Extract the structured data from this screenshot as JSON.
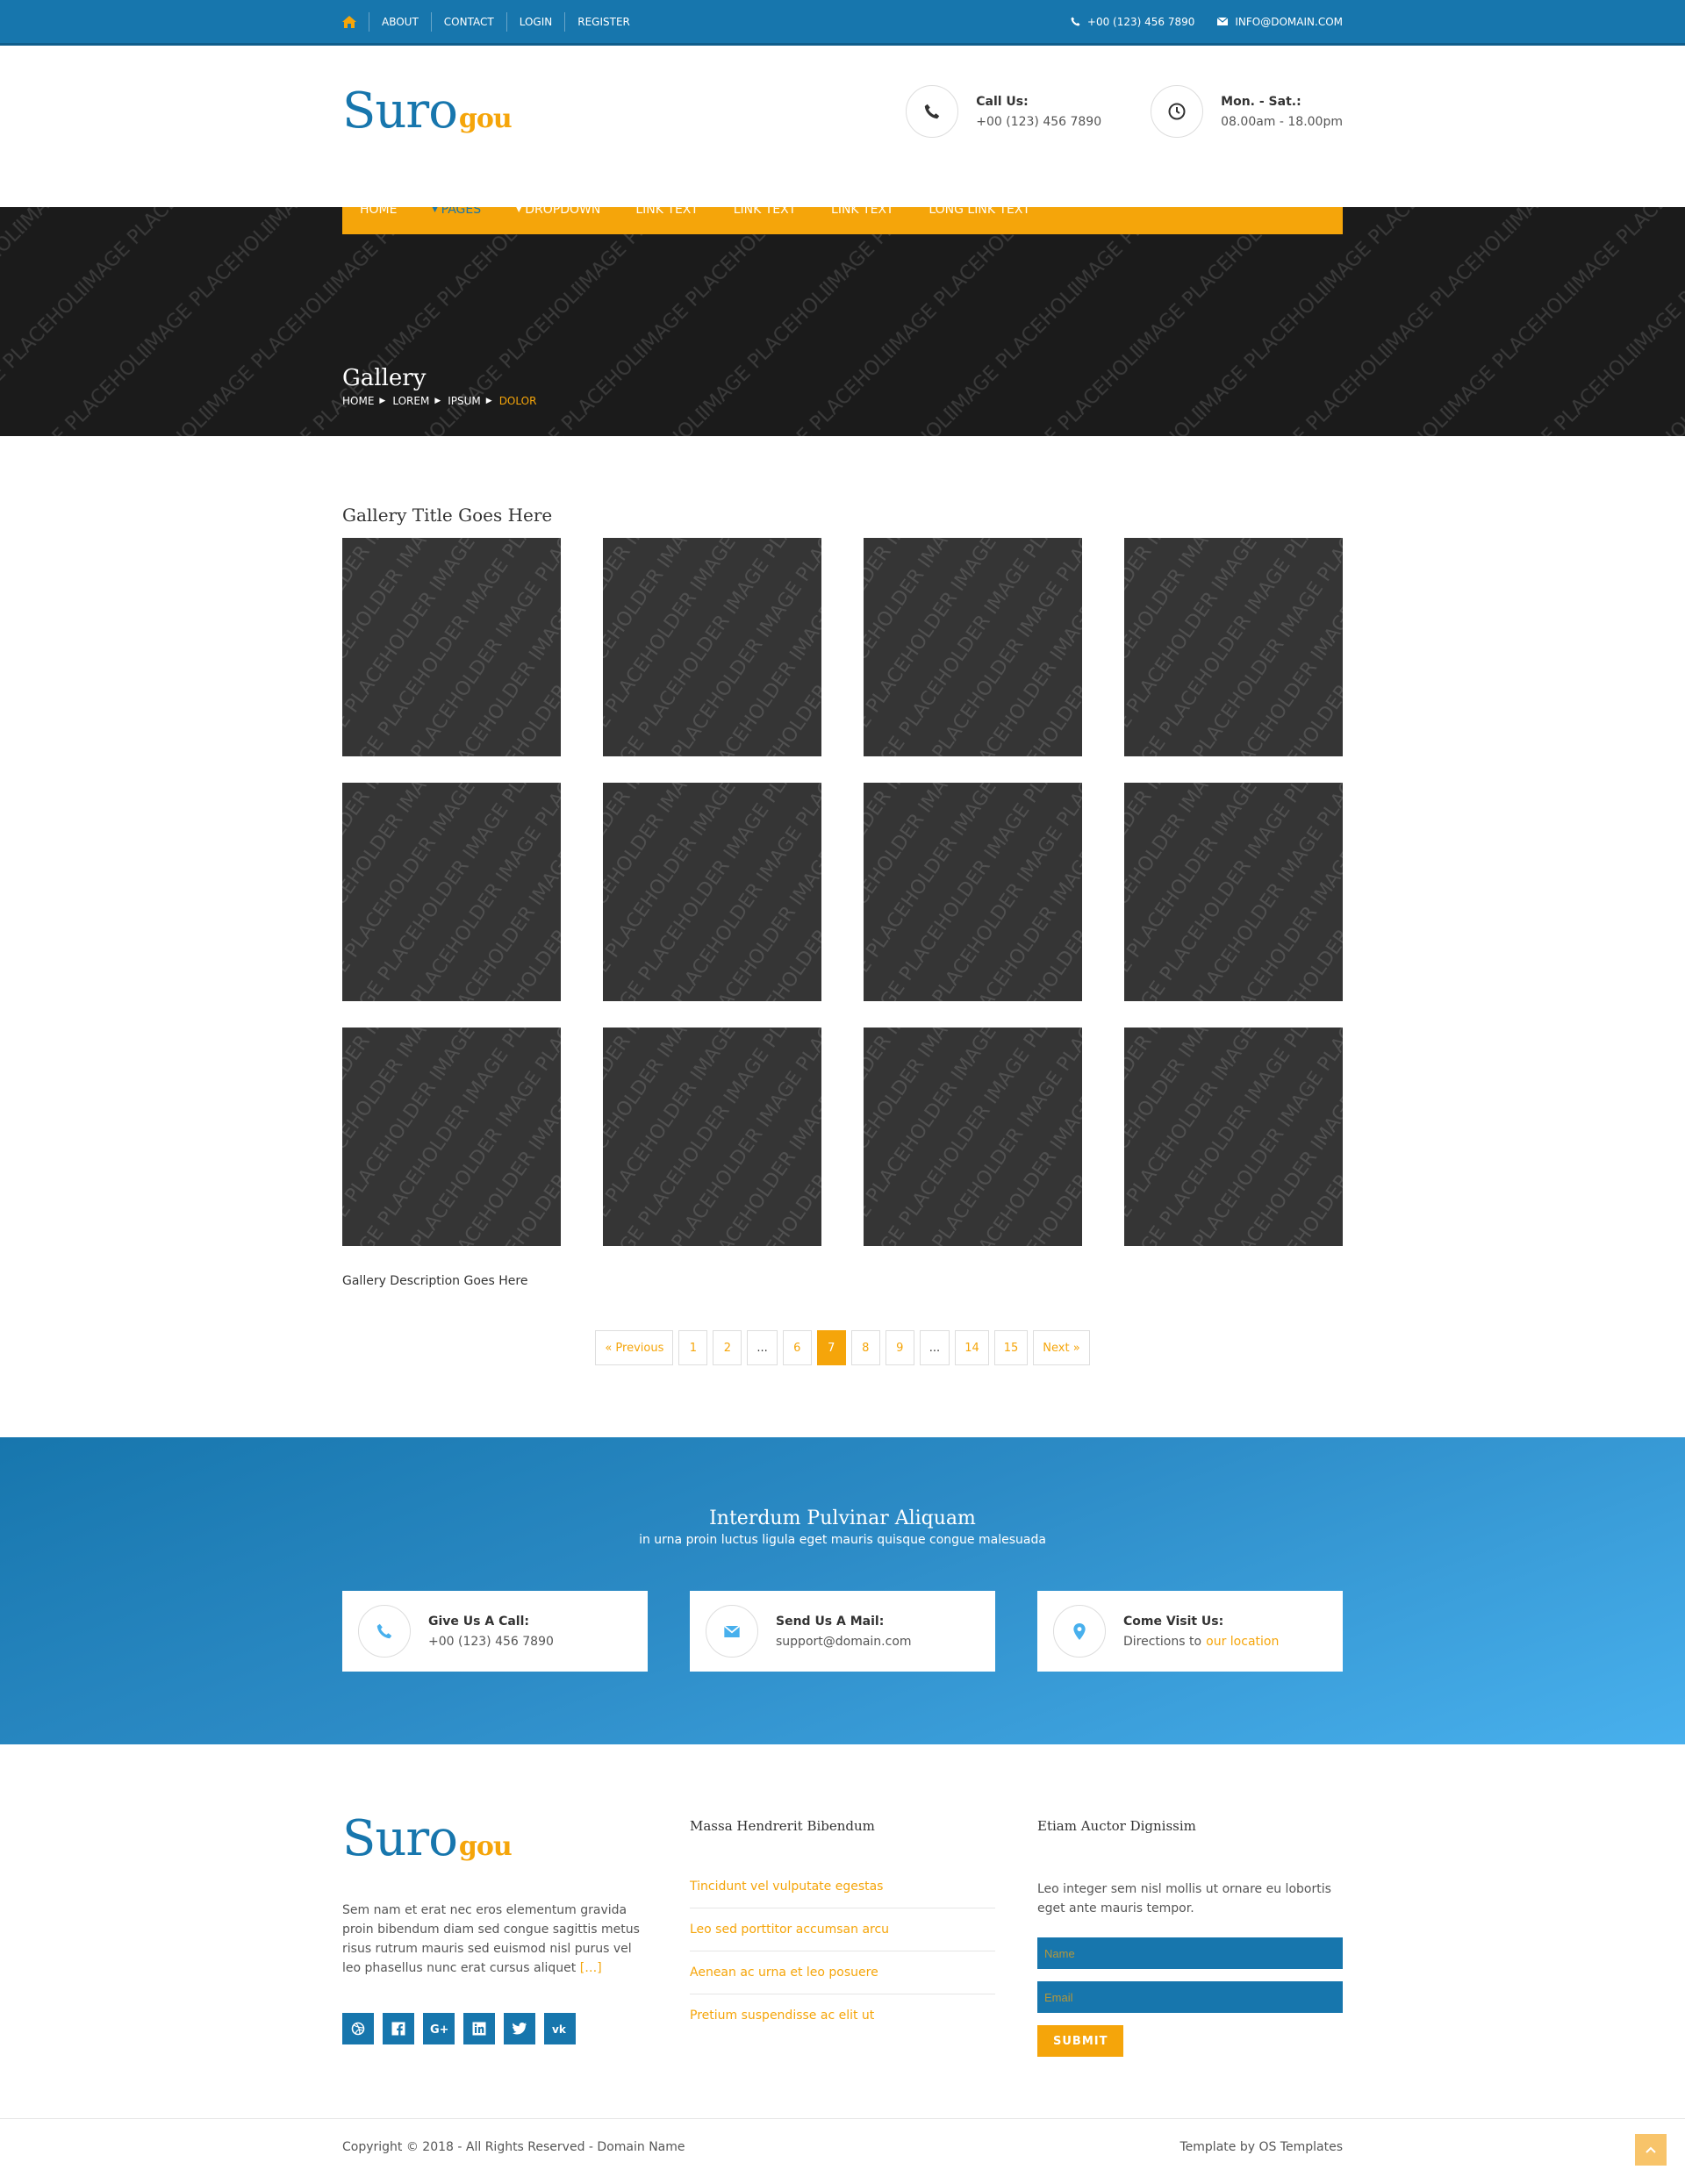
{
  "topbar": {
    "links": [
      "ABOUT",
      "CONTACT",
      "LOGIN",
      "REGISTER"
    ],
    "phone": "+00 (123) 456 7890",
    "email": "INFO@DOMAIN.COM"
  },
  "brand": {
    "name": "Suro",
    "suffix": "gou"
  },
  "header": {
    "call_label": "Call Us:",
    "call_value": "+00 (123) 456 7890",
    "hours_label": "Mon. - Sat.:",
    "hours_value": "08.00am - 18.00pm"
  },
  "nav": [
    "HOME",
    "PAGES",
    "DROPDOWN",
    "LINK TEXT",
    "LINK TEXT",
    "LINK TEXT",
    "LONG LINK TEXT"
  ],
  "hero": {
    "title": "Gallery",
    "breadcrumb": [
      "HOME",
      "LOREM",
      "IPSUM",
      "DOLOR"
    ],
    "placeholder_text": "IMAGE PLACEHOLDER"
  },
  "gallery": {
    "title": "Gallery Title Goes Here",
    "description": "Gallery Description Goes Here",
    "placeholder_text": "IMAGE PLACEHOLDER"
  },
  "pagination": {
    "prev": "« Previous",
    "pages": [
      "1",
      "2",
      "...",
      "6",
      "7",
      "8",
      "9",
      "...",
      "14",
      "15"
    ],
    "current": "7",
    "next": "Next »"
  },
  "contact_band": {
    "title": "Interdum Pulvinar Aliquam",
    "subtitle": "in urna proin luctus ligula eget mauris quisque congue malesuada",
    "call_label": "Give Us A Call:",
    "call_value": "+00 (123) 456 7890",
    "mail_label": "Send Us A Mail:",
    "mail_value": "support@domain.com",
    "visit_label": "Come Visit Us:",
    "visit_text": "Directions to",
    "visit_link": "our location"
  },
  "footer": {
    "about": "Sem nam et erat nec eros elementum gravida proin bibendum diam sed congue sagittis metus risus rutrum mauris sed euismod nisl purus vel leo phasellus nunc erat cursus aliquet",
    "more": "[…]",
    "social": [
      "dribbble-icon",
      "facebook-icon",
      "google-plus-icon",
      "linkedin-icon",
      "twitter-icon",
      "vk-icon"
    ],
    "col2_title": "Massa Hendrerit Bibendum",
    "col2_links": [
      "Tincidunt vel vulputate egestas",
      "Leo sed porttitor accumsan arcu",
      "Aenean ac urna et leo posuere",
      "Pretium suspendisse ac elit ut"
    ],
    "col3_title": "Etiam Auctor Dignissim",
    "col3_text": "Leo integer sem nisl mollis ut ornare eu lobortis eget ante mauris tempor.",
    "name_placeholder": "Name",
    "email_placeholder": "Email",
    "submit": "SUBMIT"
  },
  "copyright": {
    "left": "Copyright © 2018 - All Rights Reserved - Domain Name",
    "right": "Template by OS Templates"
  },
  "colors": {
    "primary": "#1776ad",
    "accent": "#f5a50a"
  }
}
